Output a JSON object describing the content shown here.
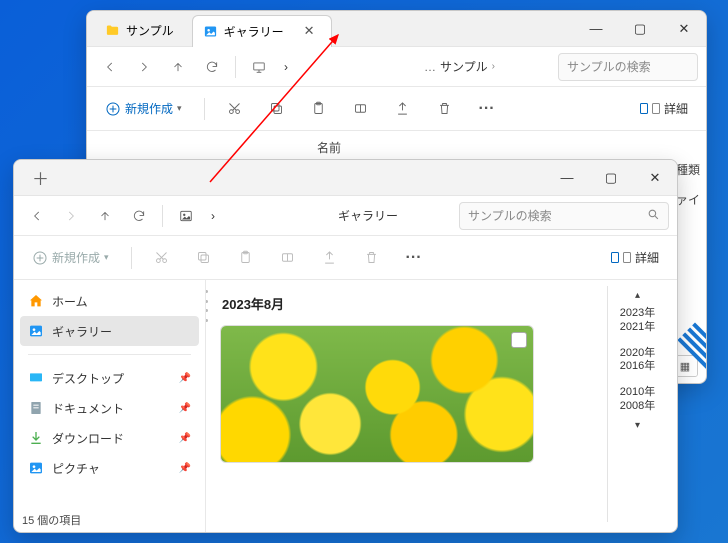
{
  "back": {
    "tabs": [
      {
        "icon": "folder",
        "label": "サンプル"
      },
      {
        "icon": "gallery",
        "label": "ギャラリー"
      }
    ],
    "nav": {
      "crumbs": [
        "サンプル"
      ],
      "search_ph": "サンプルの検索"
    },
    "cmd": {
      "new_label": "新規作成",
      "detail_label": "詳細"
    },
    "cols": {
      "name": "名前",
      "type": "種類",
      "file": "ファイ"
    }
  },
  "front": {
    "nav": {
      "crumbs": [
        "ギャラリー"
      ],
      "search_ph": "サンプルの検索",
      "new_label": "新規作成",
      "detail_label": "詳細"
    },
    "sidebar": {
      "home": "ホーム",
      "gallery": "ギャラリー",
      "desktop": "デスクトップ",
      "documents": "ドキュメント",
      "downloads": "ダウンロード",
      "pictures": "ピクチャ"
    },
    "main": {
      "group": "2023年8月",
      "timeline": [
        [
          "2023年",
          "2021年"
        ],
        [
          "2020年",
          "2016年"
        ],
        [
          "2010年",
          "2008年"
        ]
      ]
    },
    "status": "15 個の項目"
  }
}
